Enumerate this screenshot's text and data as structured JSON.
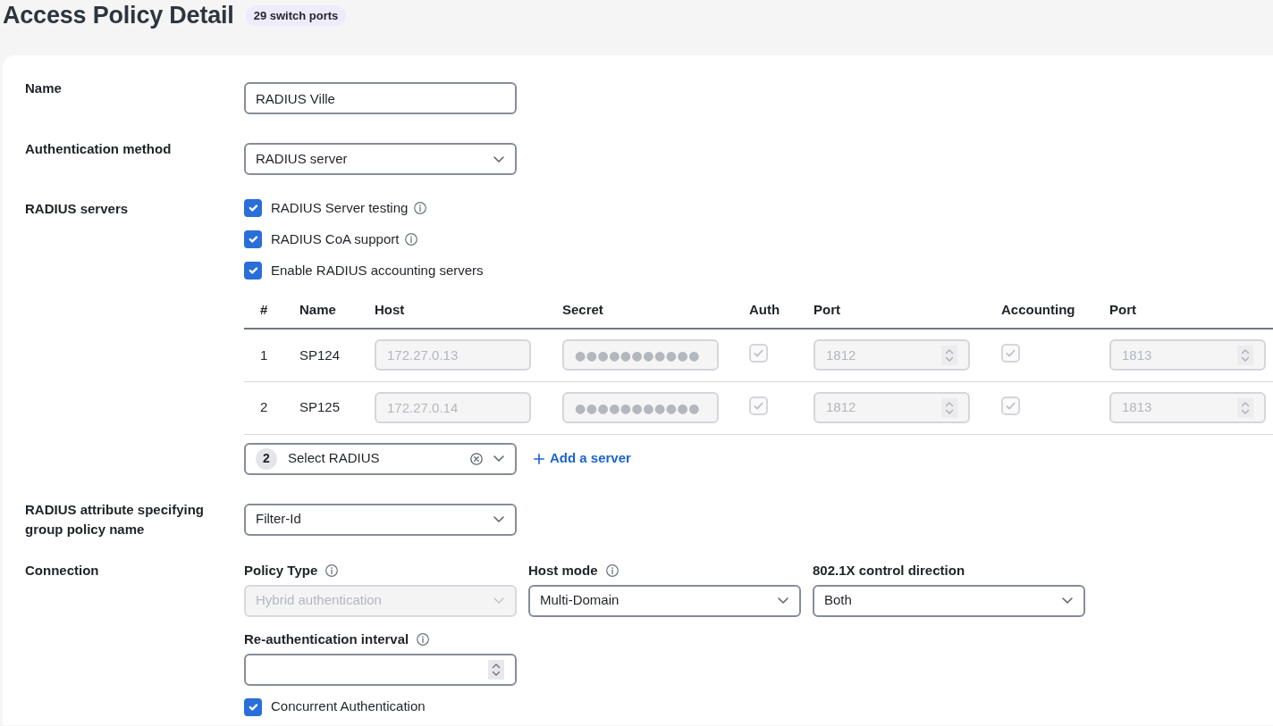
{
  "header": {
    "title": "Access Policy Detail",
    "badge": "29 switch ports"
  },
  "name": {
    "label": "Name",
    "value": "RADIUS Ville"
  },
  "authentication_method": {
    "label": "Authentication method",
    "value": "RADIUS server"
  },
  "radius_servers": {
    "label": "RADIUS servers",
    "options": [
      {
        "label": "RADIUS Server testing",
        "checked": true,
        "info": true
      },
      {
        "label": "RADIUS CoA support",
        "checked": true,
        "info": true
      },
      {
        "label": "Enable RADIUS accounting servers",
        "checked": true,
        "info": false
      }
    ],
    "table": {
      "columns": [
        "#",
        "Name",
        "Host",
        "Secret",
        "Auth",
        "Port",
        "Accounting",
        "Port"
      ],
      "rows": [
        {
          "number": "1",
          "name": "SP124",
          "host": "172.27.0.13",
          "secret": "●●●●●●●●●●●",
          "auth": true,
          "auth_port": "1812",
          "accounting": true,
          "accounting_port": "1813"
        },
        {
          "number": "2",
          "name": "SP125",
          "host": "172.27.0.14",
          "secret": "●●●●●●●●●●●",
          "auth": true,
          "auth_port": "1812",
          "accounting": true,
          "accounting_port": "1813"
        }
      ]
    },
    "picker": {
      "count": "2",
      "text": "Select RADIUS"
    },
    "add_link": "Add a server"
  },
  "group_policy_attribute": {
    "label": "RADIUS attribute specifying group policy name",
    "value": "Filter-Id"
  },
  "connection": {
    "label": "Connection",
    "selects": [
      {
        "label": "Policy Type",
        "info": true,
        "value": "Hybrid authentication",
        "disabled": true
      },
      {
        "label": "Host mode",
        "info": true,
        "value": "Multi-Domain",
        "disabled": false
      },
      {
        "label": "802.1X control direction",
        "info": false,
        "value": "Both",
        "disabled": false
      }
    ],
    "reauthentication": {
      "label": "Re-authentication interval",
      "info": true
    },
    "concurrent": {
      "label": "Concurrent Authentication",
      "checked": true
    }
  }
}
